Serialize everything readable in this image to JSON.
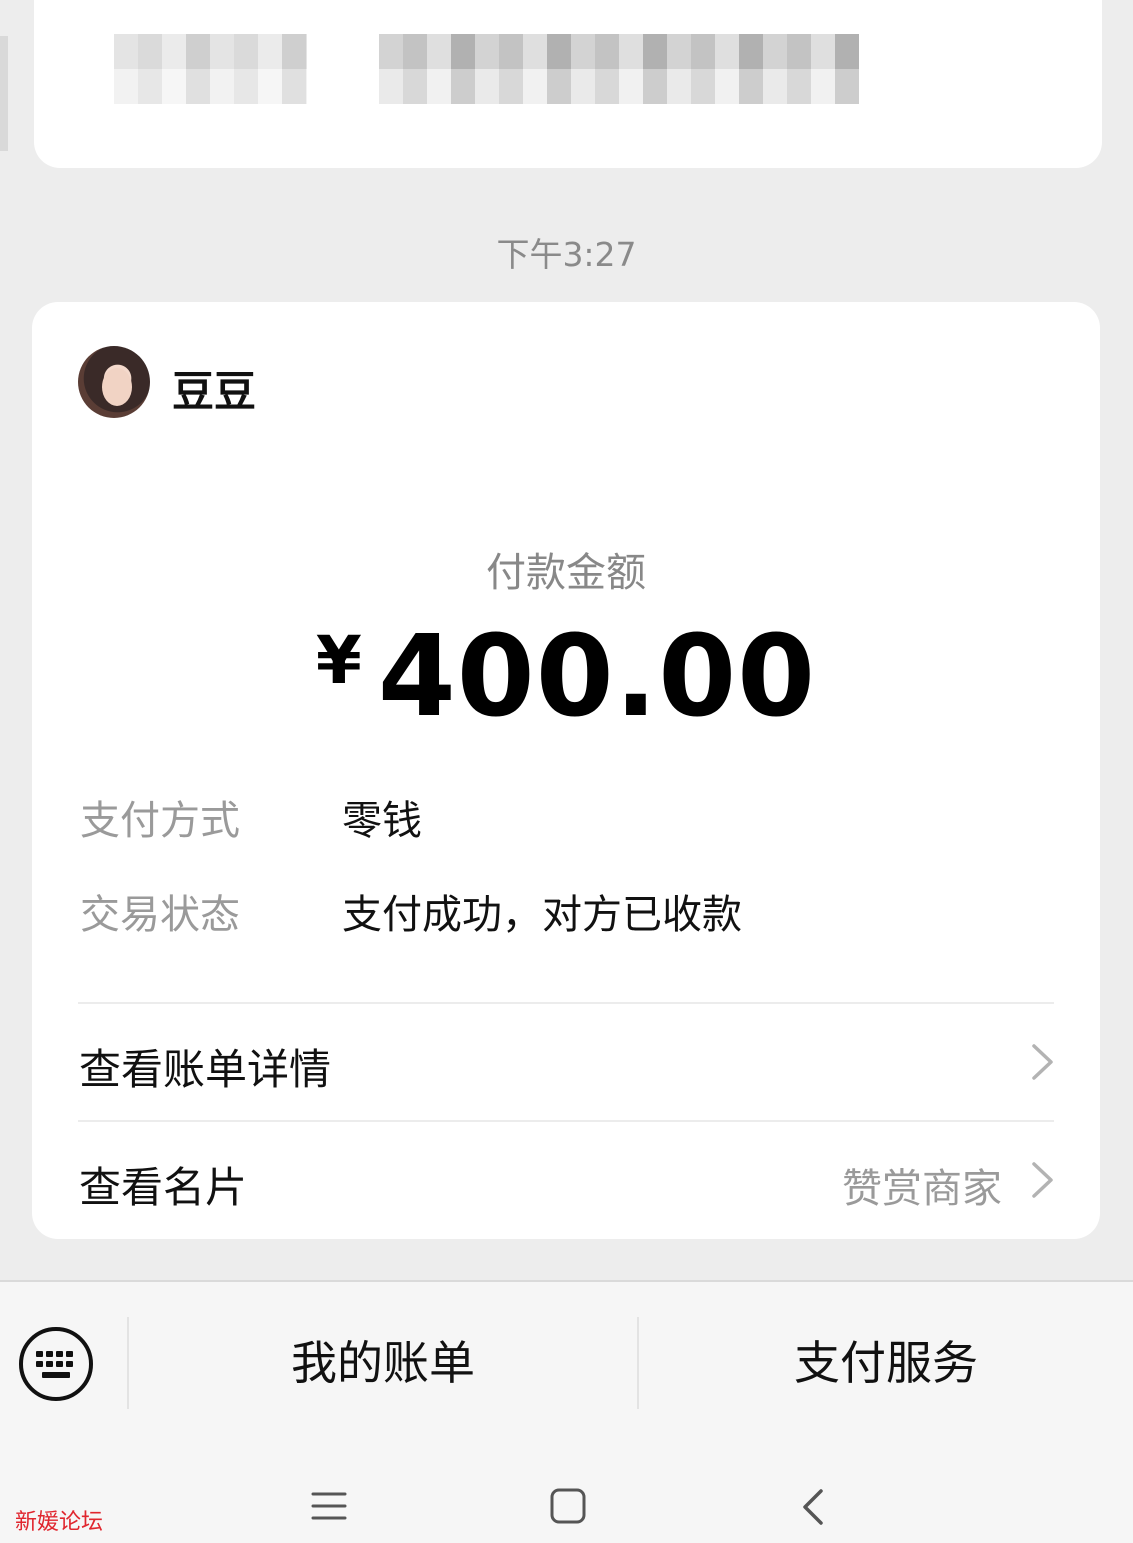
{
  "timestamp": "下午3:27",
  "payment": {
    "payee_name": "豆豆",
    "amount_label": "付款金额",
    "currency_symbol": "¥",
    "amount": "400.00",
    "details": [
      {
        "key": "支付方式",
        "value": "零钱"
      },
      {
        "key": "交易状态",
        "value": "支付成功，对方已收款"
      }
    ],
    "links": [
      {
        "label": "查看账单详情",
        "hint": ""
      },
      {
        "label": "查看名片",
        "hint": "赞赏商家"
      }
    ]
  },
  "service_bar": {
    "bills_label": "我的账单",
    "services_label": "支付服务"
  },
  "watermark": "新媛论坛",
  "colors": {
    "page_background": "#ededed",
    "card_background": "#ffffff",
    "muted_text": "#9a9a9a",
    "primary_text": "#111111",
    "watermark": "#e0262e"
  },
  "icons": {
    "keyboard": "keyboard-icon",
    "chevron": "chevron-right-icon",
    "nav_menu": "menu-icon",
    "nav_home": "home-square-icon",
    "nav_back": "back-chevron-icon"
  }
}
